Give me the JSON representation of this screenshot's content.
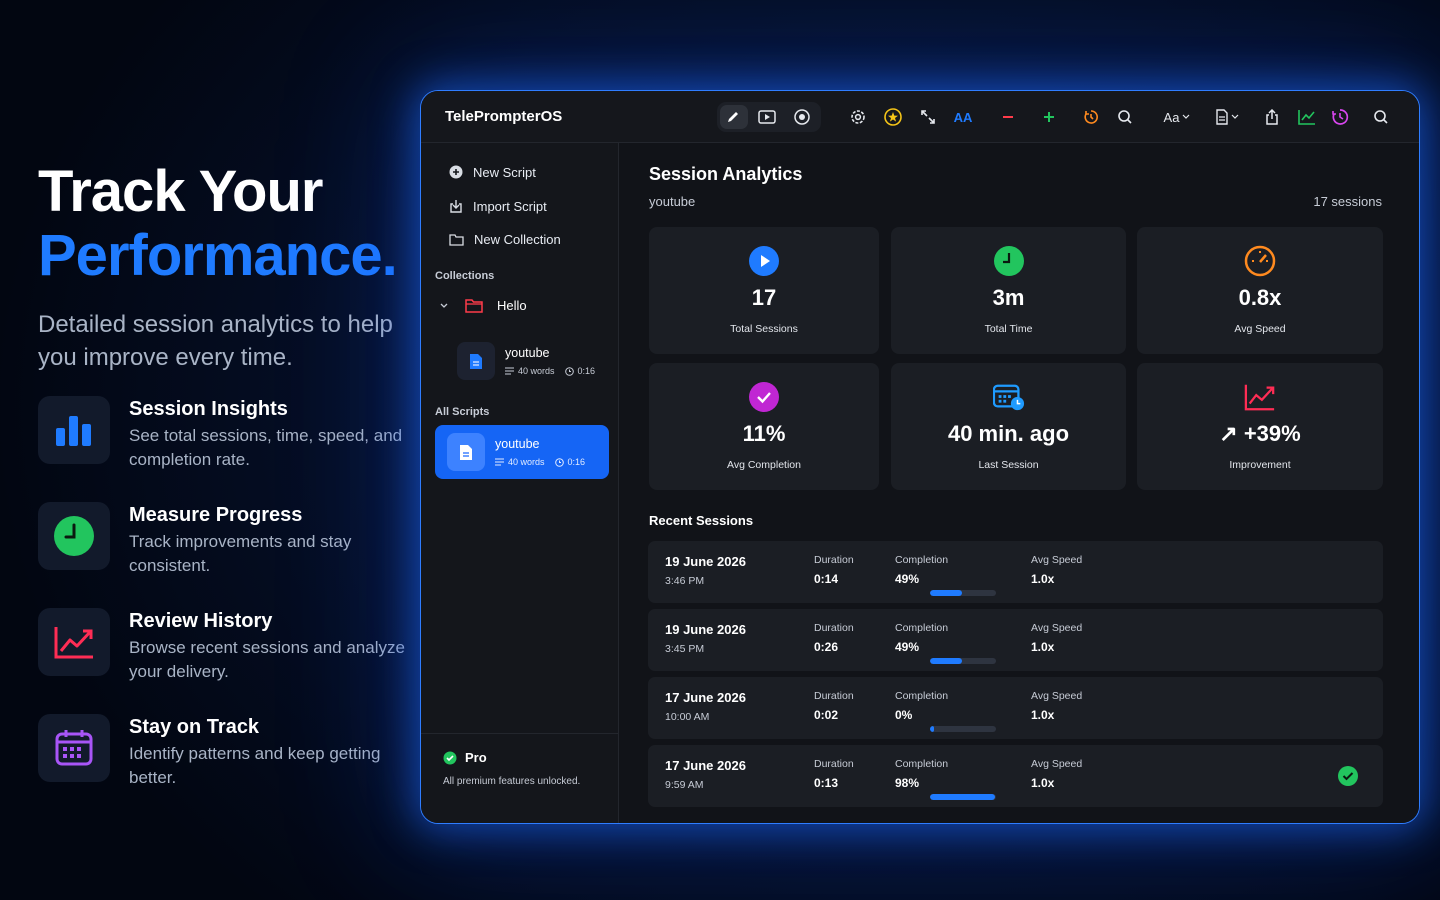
{
  "hero": {
    "line1": "Track Your",
    "line2": "Performance.",
    "subtitle": "Detailed session analytics to help you improve every time."
  },
  "features": [
    {
      "title": "Session Insights",
      "desc": "See total sessions, time, speed, and completion rate.",
      "icon": "bar-chart-icon",
      "color": "#1f7bff"
    },
    {
      "title": "Measure Progress",
      "desc": "Track improvements and stay consistent.",
      "icon": "clock-icon",
      "color": "#22c55e"
    },
    {
      "title": "Review History",
      "desc": "Browse recent sessions and analyze your delivery.",
      "icon": "trend-up-icon",
      "color": "#ff2d55"
    },
    {
      "title": "Stay on Track",
      "desc": "Identify patterns and keep getting better.",
      "icon": "calendar-icon",
      "color": "#a855f7"
    }
  ],
  "window": {
    "title": "TelePrompterOS",
    "toolbar": {
      "font_size_label": "AA",
      "font_label": "Aa"
    }
  },
  "sidebar": {
    "actions": [
      "New Script",
      "Import Script",
      "New Collection"
    ],
    "collections_label": "Collections",
    "collection_name": "Hello",
    "collection_script": {
      "name": "youtube",
      "words": "40 words",
      "duration": "0:16"
    },
    "all_scripts_label": "All Scripts",
    "selected_script": {
      "name": "youtube",
      "words": "40 words",
      "duration": "0:16"
    },
    "plan": {
      "name": "Pro",
      "desc": "All premium features unlocked."
    }
  },
  "main": {
    "title": "Session Analytics",
    "script": "youtube",
    "count": "17 sessions",
    "stats": [
      {
        "value": "17",
        "label": "Total Sessions",
        "icon": "play-icon",
        "color": "#1f7bff"
      },
      {
        "value": "3m",
        "label": "Total Time",
        "icon": "clock-icon",
        "color": "#22c55e"
      },
      {
        "value": "0.8x",
        "label": "Avg Speed",
        "icon": "speedometer-icon",
        "color": "#ff8a1f"
      },
      {
        "value": "11%",
        "label": "Avg Completion",
        "icon": "check-circle-icon",
        "color": "#c026d3"
      },
      {
        "value": "40 min. ago",
        "label": "Last Session",
        "icon": "calendar-clock-icon",
        "color": "#1f9bff"
      },
      {
        "value": "↗ +39%",
        "label": "Improvement",
        "icon": "trend-up-icon",
        "color": "#ff2d55"
      }
    ],
    "recent_title": "Recent Sessions",
    "col_duration": "Duration",
    "col_completion": "Completion",
    "col_speed": "Avg Speed",
    "sessions": [
      {
        "date": "19 June 2026",
        "time": "3:46 PM",
        "duration": "0:14",
        "completion": "49%",
        "completion_value": 0.49,
        "speed": "1.0x",
        "done": false
      },
      {
        "date": "19 June 2026",
        "time": "3:45 PM",
        "duration": "0:26",
        "completion": "49%",
        "completion_value": 0.49,
        "speed": "1.0x",
        "done": false
      },
      {
        "date": "17 June 2026",
        "time": "10:00 AM",
        "duration": "0:02",
        "completion": "0%",
        "completion_value": 0.0,
        "speed": "1.0x",
        "done": false
      },
      {
        "date": "17 June 2026",
        "time": "9:59 AM",
        "duration": "0:13",
        "completion": "98%",
        "completion_value": 0.98,
        "speed": "1.0x",
        "done": true
      }
    ]
  }
}
